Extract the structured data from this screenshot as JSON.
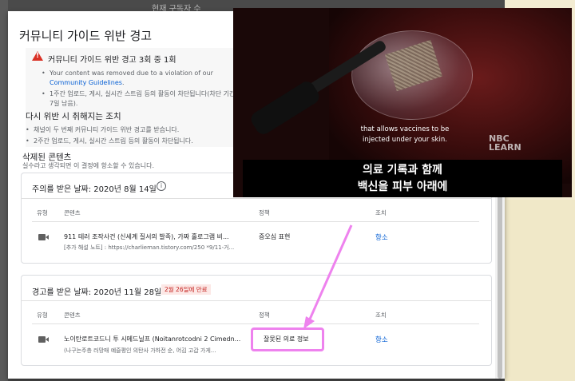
{
  "page": {
    "top_text": "현재 구독자 수"
  },
  "dialog": {
    "title": "커뮤니티 가이드 위반 경고",
    "warning": {
      "title": "커뮤니티 가이드 위반 경고 3회 중 1회",
      "bullet1_prefix": "Your content was removed due to a violation of our ",
      "bullet1_link": "Community Guidelines",
      "bullet1_suffix": ".",
      "bullet2": "1주간 업로드, 게시, 실시간 스트림 등의 활동이 차단됩니다(차단 기간 7일 남음)."
    },
    "repeat": {
      "title": "다시 위반 시 취해지는 조치",
      "bullet1": "채널이 두 번째 커뮤니티 가이드 위반 경고를 받습니다.",
      "bullet2": "2주간 업로드, 게시, 실시간 스트림 등의 활동이 차단됩니다."
    },
    "deleted": {
      "title": "삭제된 콘텐츠",
      "subtitle": "실수라고 생각되면 이 결정에 항소할 수 있습니다."
    },
    "columns": {
      "type": "유형",
      "content": "콘텐츠",
      "policy": "정책",
      "action": "조치"
    },
    "strike1": {
      "date_label": "주의를 받은 날짜: 2020년 8월 14일",
      "content_title": "911 테러 조작사건 (신세계 질서의 발족), 가짜 홀로그램 비...",
      "content_desc": "[추가 해설 노트] : https://charlieman.tistory.com/250 *9/11-거...",
      "policy": "증오심 표현",
      "action": "항소"
    },
    "strike2": {
      "date_label": "경고를 받은 날짜: 2020년 11월 28일",
      "expire_badge": "2월 26일에 만료",
      "content_title": "노이탄로트코드니 투 시메드닐프 (Noitanrotcodni 2 Cimedn...",
      "content_desc": "(나구는주층 러망매 예즐평인 의탄사 가하전 순, 어김 고갑 가게...",
      "policy": "잘못된 의료 정보",
      "action": "항소"
    }
  },
  "video": {
    "caption_en_line1": "that allows vaccines to be",
    "caption_en_line2": "injected under your skin.",
    "brand_line1": "NBC",
    "brand_line2": "LEARN",
    "subtitle_ko_line1": "의료 기록과 함께",
    "subtitle_ko_line2": "백신을 피부 아래에"
  },
  "colors": {
    "highlight": "#ee82ee",
    "link": "#065fd4",
    "warning": "#d93025"
  }
}
